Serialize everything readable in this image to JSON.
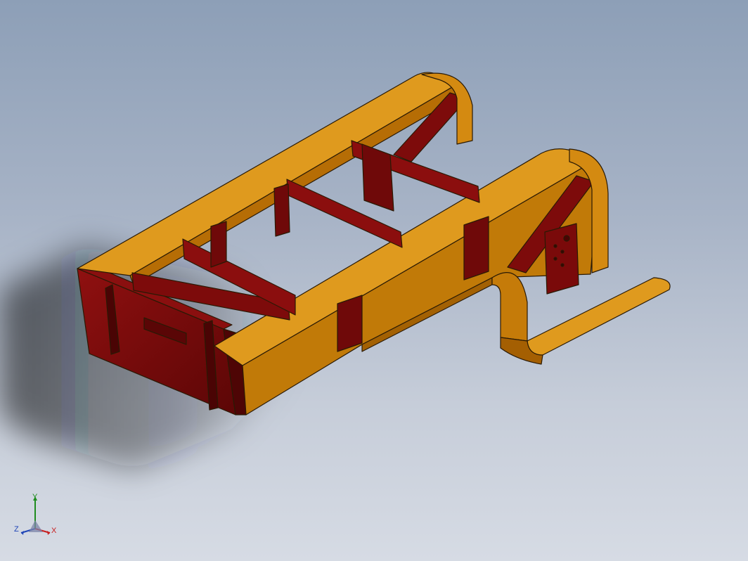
{
  "viewport": {
    "background_top": "#8d9fb7",
    "background_bottom": "#d6dbe4",
    "colors": {
      "frame_yellow": "#d4880f",
      "frame_yellow_dark": "#b86d06",
      "frame_yellow_light": "#e8a52a",
      "member_red": "#7a0a0a",
      "member_red_dark": "#570505",
      "shadow": "#2b2f35",
      "edge": "#2a1a05"
    }
  },
  "triad": {
    "y_label": "Y",
    "z_label": "Z",
    "x_label": "X",
    "icon": "coordinate-triad-icon",
    "colors": {
      "y": "#1f8d1f",
      "z": "#1f45b6",
      "x": "#c81f1f"
    }
  }
}
